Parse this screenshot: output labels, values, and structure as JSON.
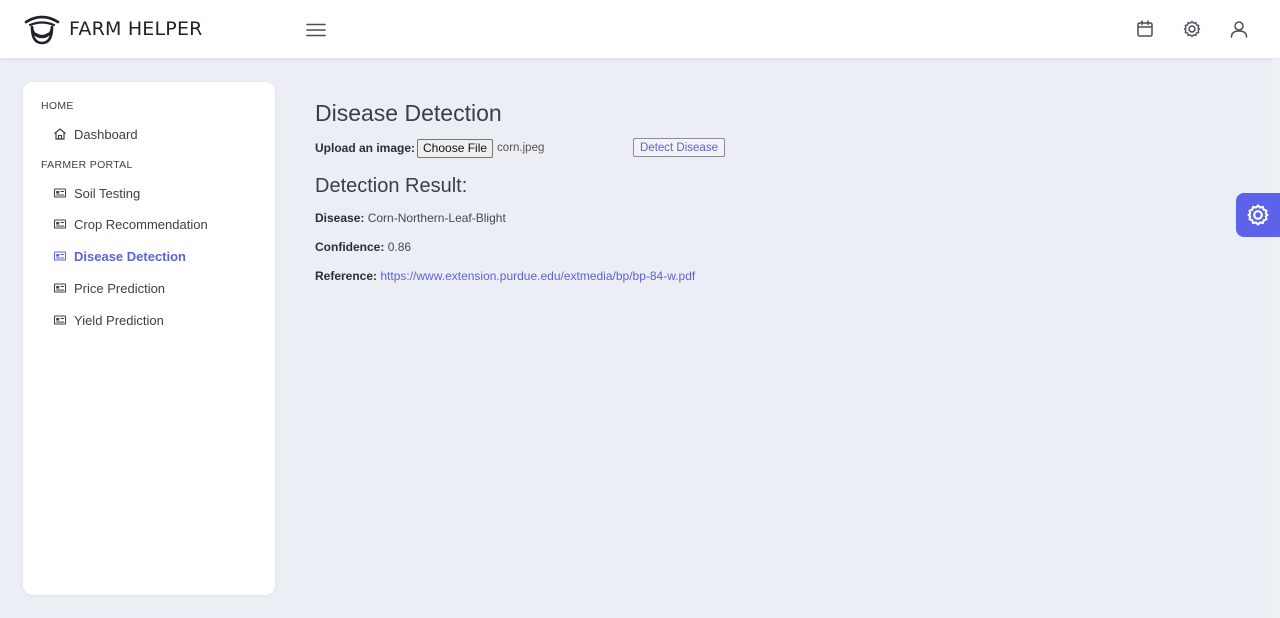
{
  "app": {
    "brand_name": "FARM HELPER"
  },
  "header": {
    "icons": [
      "menu-icon",
      "calendar-icon",
      "gear-icon",
      "user-icon"
    ]
  },
  "sidebar": {
    "sections": [
      {
        "title": "HOME",
        "items": [
          {
            "label": "Dashboard",
            "icon": "home-icon"
          }
        ]
      },
      {
        "title": "FARMER PORTAL",
        "items": [
          {
            "label": "Soil Testing",
            "icon": "id-card-icon"
          },
          {
            "label": "Crop Recommendation",
            "icon": "id-card-icon"
          },
          {
            "label": "Disease Detection",
            "icon": "id-card-icon",
            "active": true
          },
          {
            "label": "Price Prediction",
            "icon": "id-card-icon"
          },
          {
            "label": "Yield Prediction",
            "icon": "id-card-icon"
          }
        ]
      }
    ]
  },
  "main": {
    "title": "Disease Detection",
    "upload": {
      "label": "Upload an image:",
      "button_label": "Choose File",
      "file_name": "corn.jpeg"
    },
    "detect_button_label": "Detect Disease",
    "result": {
      "title": "Detection Result:",
      "disease_label": "Disease:",
      "disease_value": "Corn-Northern-Leaf-Blight",
      "confidence_label": "Confidence:",
      "confidence_value": "0.86",
      "reference_label": "Reference:",
      "reference_url": "https://www.extension.purdue.edu/extmedia/bp/bp-84-w.pdf"
    }
  },
  "colors": {
    "accent": "#5c63d8",
    "floating_button": "#5c63e8",
    "page_background": "#ebeef4",
    "card_background": "#ffffff"
  }
}
